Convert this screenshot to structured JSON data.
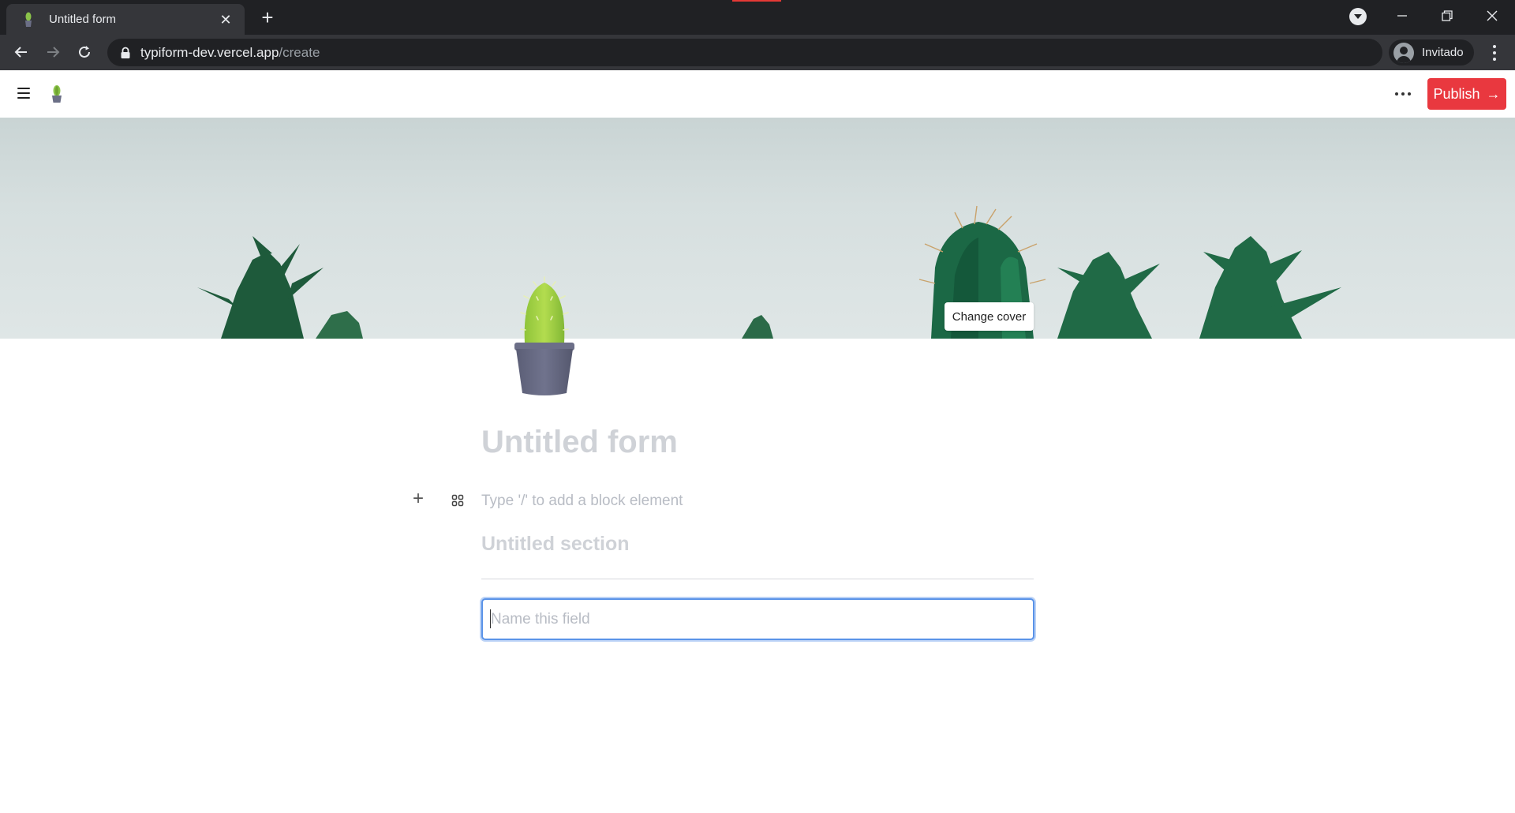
{
  "browser": {
    "tab_title": "Untitled form",
    "tab_close": "✕",
    "new_tab": "+",
    "url_host": "typiform-dev.vercel.app",
    "url_path": "/create",
    "profile_name": "Invitado"
  },
  "app": {
    "publish_label": "Publish",
    "publish_arrow": "→",
    "change_cover_label": "Change cover",
    "form_title_placeholder": "Untitled form",
    "block_add": "+",
    "block_placeholder": "Type '/' to add a block element",
    "section_title_placeholder": "Untitled section",
    "field_placeholder": "Name this field"
  },
  "colors": {
    "accent_red": "#e9383f",
    "focus_blue": "#5a93e8",
    "placeholder_gray": "#cfd2d7"
  }
}
